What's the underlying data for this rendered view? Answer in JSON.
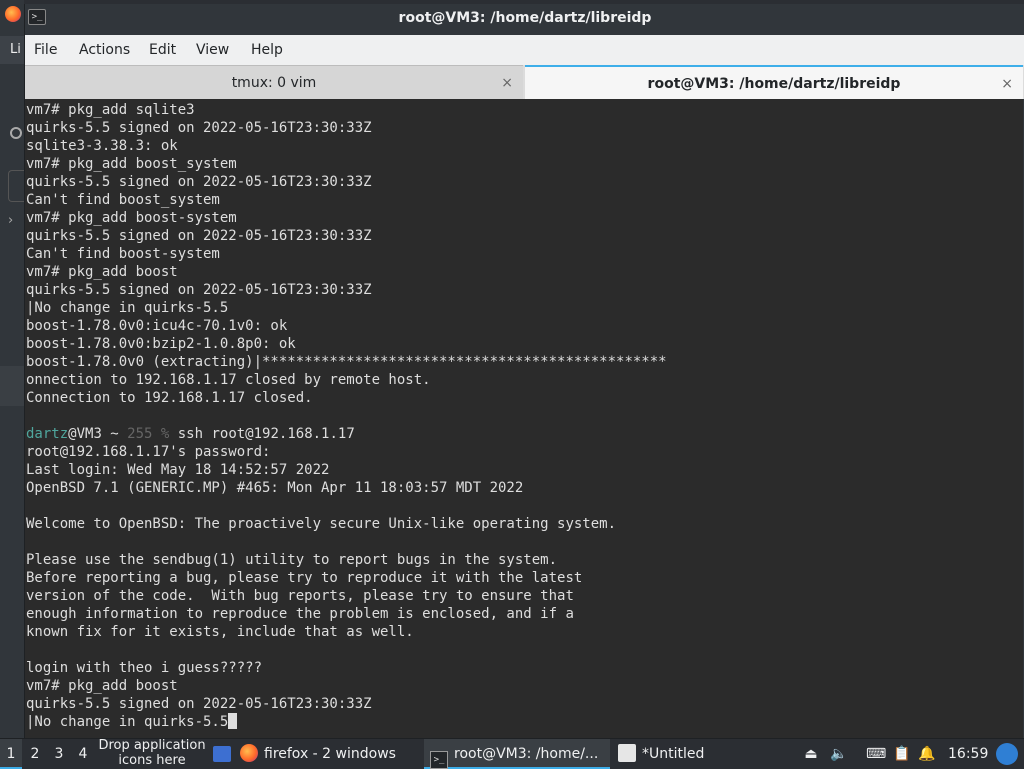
{
  "window": {
    "title": "root@VM3: /home/dartz/libreidp",
    "app_icon": ">_"
  },
  "desktop": {
    "left_label": "Li"
  },
  "menubar": {
    "items": [
      "File",
      "Actions",
      "Edit",
      "View",
      "Help"
    ]
  },
  "tabs": [
    {
      "label": "tmux: 0 vim",
      "active": false,
      "close": "×"
    },
    {
      "label": "root@VM3: /home/dartz/libreidp",
      "active": true,
      "close": "×"
    }
  ],
  "terminal": {
    "lines": [
      "vm7# pkg_add sqlite3",
      "quirks-5.5 signed on 2022-05-16T23:30:33Z",
      "sqlite3-3.38.3: ok",
      "vm7# pkg_add boost_system",
      "quirks-5.5 signed on 2022-05-16T23:30:33Z",
      "Can't find boost_system",
      "vm7# pkg_add boost-system",
      "quirks-5.5 signed on 2022-05-16T23:30:33Z",
      "Can't find boost-system",
      "vm7# pkg_add boost",
      "quirks-5.5 signed on 2022-05-16T23:30:33Z",
      "|No change in quirks-5.5",
      "boost-1.78.0v0:icu4c-70.1v0: ok",
      "boost-1.78.0v0:bzip2-1.0.8p0: ok",
      "boost-1.78.0v0 (extracting)|************************************************",
      "onnection to 192.168.1.17 closed by remote host.",
      "Connection to 192.168.1.17 closed.",
      ""
    ],
    "prompt": {
      "user": "dartz",
      "host": "@VM3 ~ ",
      "status": "255 %",
      "command": " ssh root@192.168.1.17"
    },
    "lines2": [
      "root@192.168.1.17's password:",
      "Last login: Wed May 18 14:52:57 2022",
      "OpenBSD 7.1 (GENERIC.MP) #465: Mon Apr 11 18:03:57 MDT 2022",
      "",
      "Welcome to OpenBSD: The proactively secure Unix-like operating system.",
      "",
      "Please use the sendbug(1) utility to report bugs in the system.",
      "Before reporting a bug, please try to reproduce it with the latest",
      "version of the code.  With bug reports, please try to ensure that",
      "enough information to reproduce the problem is enclosed, and if a",
      "known fix for it exists, include that as well.",
      "",
      "login with theo i guess?????",
      "vm7# pkg_add boost",
      "quirks-5.5 signed on 2022-05-16T23:30:33Z"
    ],
    "last_line": "|No change in quirks-5.5"
  },
  "taskbar": {
    "workspaces": [
      "1",
      "2",
      "3",
      "4"
    ],
    "active_workspace": "1",
    "drop_text": "Drop application icons here",
    "tasks": [
      {
        "label": "firefox - 2 windows",
        "icon": "firefox-icon"
      },
      {
        "label": "root@VM3: /home/...",
        "icon": "terminal-icon",
        "active": true
      },
      {
        "label": "*Untitled",
        "icon": "text-editor-icon"
      }
    ],
    "clock": "16:59"
  }
}
